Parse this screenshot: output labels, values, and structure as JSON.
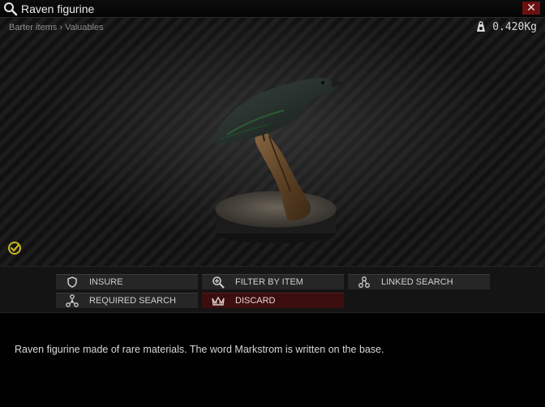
{
  "window": {
    "title": "Raven figurine",
    "close_label": "✕"
  },
  "header": {
    "breadcrumb": "Barter items › Valuables",
    "weight": "0.420Kg"
  },
  "actions": {
    "insure": "INSURE",
    "filter_by_item": "FILTER BY ITEM",
    "linked_search": "LINKED SEARCH",
    "required_search": "REQUIRED SEARCH",
    "discard": "DISCARD"
  },
  "description": "Raven figurine made of rare materials. The word Markstrom is written on the base.",
  "colors": {
    "discard_bg": "#3c0e0e",
    "close_bg": "#6a1010",
    "check_accent": "#c8b820"
  },
  "icons": {
    "title": "search-icon",
    "weight": "weight-icon",
    "examined": "check-icon",
    "insure": "shield-icon",
    "filter": "magnifier-plus-icon",
    "linked": "link-nodes-icon",
    "required": "tree-nodes-icon",
    "discard": "crown-discard-icon"
  }
}
